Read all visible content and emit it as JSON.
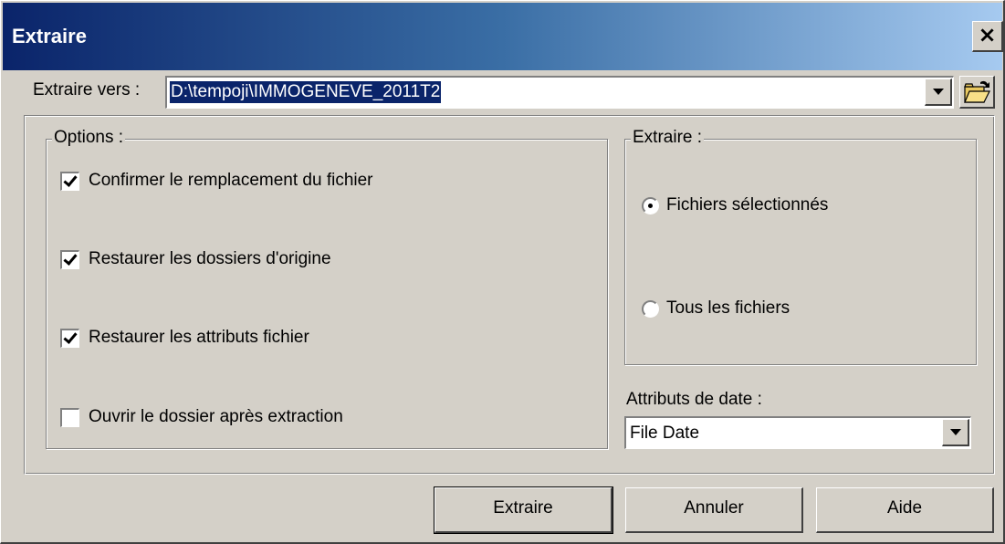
{
  "window": {
    "title": "Extraire",
    "close_glyph": "×"
  },
  "destination": {
    "label": "Extraire vers :",
    "value": "D:\\tempoji\\IMMOGENEVE_2011T2",
    "browse_icon": "folder-open-icon"
  },
  "options": {
    "title": "Options :",
    "items": [
      {
        "label": "Confirmer le remplacement du fichier",
        "checked": true
      },
      {
        "label": "Restaurer les dossiers d'origine",
        "checked": true
      },
      {
        "label": "Restaurer les attributs fichier",
        "checked": true
      },
      {
        "label": "Ouvrir le dossier après extraction",
        "checked": false
      }
    ]
  },
  "extract_scope": {
    "title": "Extraire :",
    "items": [
      {
        "label": "Fichiers sélectionnés",
        "selected": true
      },
      {
        "label": "Tous les fichiers",
        "selected": false
      }
    ]
  },
  "date_attributes": {
    "label": "Attributs de date :",
    "value": "File Date"
  },
  "buttons": {
    "extract": "Extraire",
    "cancel": "Annuler",
    "help": "Aide"
  }
}
